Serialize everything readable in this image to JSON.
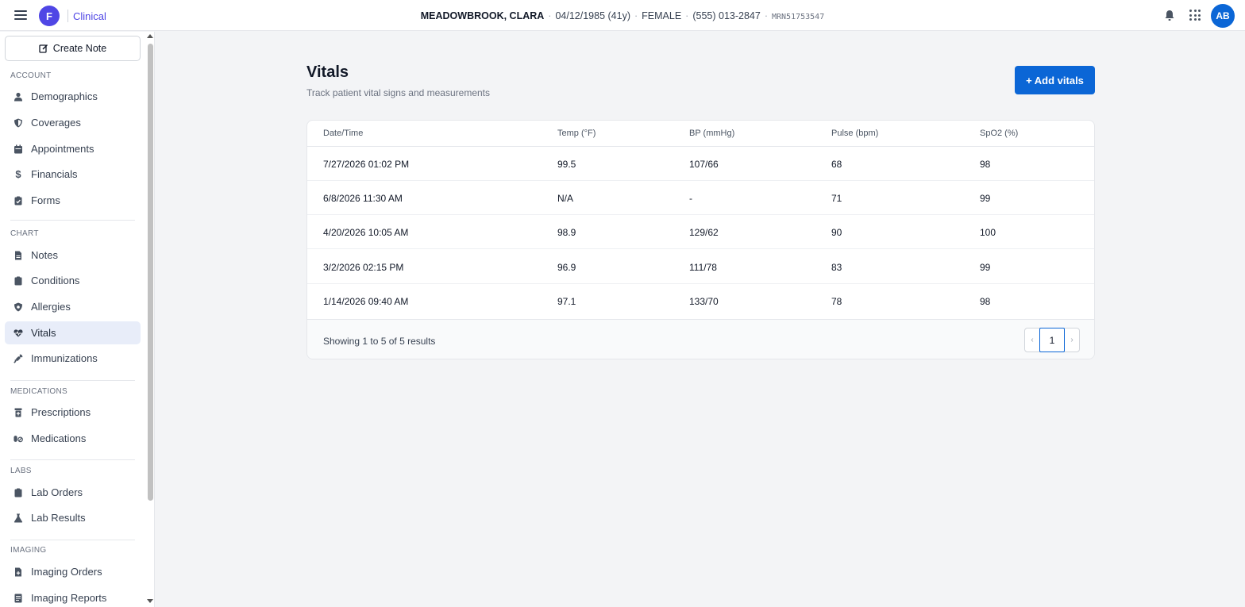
{
  "header": {
    "logo_letter": "F",
    "app_name": "Clinical",
    "patient_name": "MEADOWBROOK, CLARA",
    "dob": "04/12/1985 (41y)",
    "sex": "FEMALE",
    "phone": "(555) 013-2847",
    "mrn": "MRN51753547",
    "separator": "·",
    "avatar_initials": "AB"
  },
  "sidebar": {
    "create_note": "Create Note",
    "sections": {
      "account": "ACCOUNT",
      "chart": "CHART",
      "medications": "MEDICATIONS",
      "labs": "LABS",
      "imaging": "IMAGING"
    },
    "items": {
      "demographics": "Demographics",
      "coverages": "Coverages",
      "appointments": "Appointments",
      "financials": "Financials",
      "forms": "Forms",
      "notes": "Notes",
      "conditions": "Conditions",
      "allergies": "Allergies",
      "vitals": "Vitals",
      "immunizations": "Immunizations",
      "prescriptions": "Prescriptions",
      "medications": "Medications",
      "lab_orders": "Lab Orders",
      "lab_results": "Lab Results",
      "imaging_orders": "Imaging Orders",
      "imaging_reports": "Imaging Reports"
    },
    "active_item": "vitals"
  },
  "main": {
    "title": "Vitals",
    "subtitle": "Track patient vital signs and measurements",
    "add_button": "+ Add vitals",
    "table": {
      "columns": [
        "Date/Time",
        "Temp (°F)",
        "BP (mmHg)",
        "Pulse (bpm)",
        "SpO2 (%)"
      ],
      "rows": [
        [
          "7/27/2026 01:02 PM",
          "99.5",
          "107/66",
          "68",
          "98"
        ],
        [
          "6/8/2026 11:30 AM",
          "N/A",
          "-",
          "71",
          "99"
        ],
        [
          "4/20/2026 10:05 AM",
          "98.9",
          "129/62",
          "90",
          "100"
        ],
        [
          "3/2/2026 02:15 PM",
          "96.9",
          "111/78",
          "83",
          "99"
        ],
        [
          "1/14/2026 09:40 AM",
          "97.1",
          "133/70",
          "78",
          "98"
        ]
      ]
    },
    "footer": {
      "showing": "Showing 1 to 5 of 5 results",
      "prev": "‹",
      "page": "1",
      "next": "›"
    }
  },
  "colors": {
    "primary": "#0b66d6",
    "brand": "#4f46e5",
    "active_nav": "#e8edf9"
  }
}
